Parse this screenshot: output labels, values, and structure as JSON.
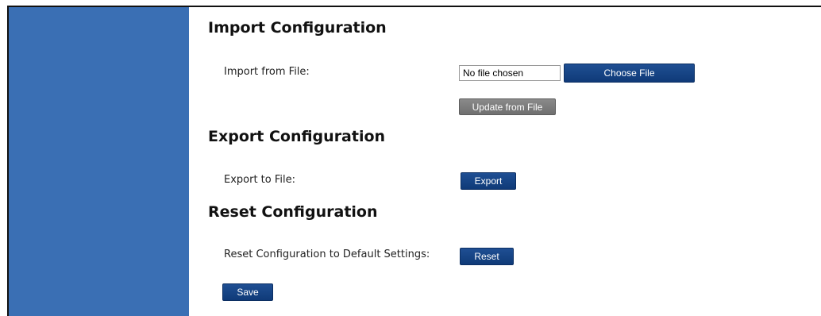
{
  "import": {
    "heading": "Import Configuration",
    "file_label": "Import from File:",
    "file_status": "No file chosen",
    "choose_button": "Choose File",
    "update_button": "Update from File"
  },
  "export": {
    "heading": "Export Configuration",
    "label": "Export to File:",
    "button": "Export"
  },
  "reset": {
    "heading": "Reset Configuration",
    "label": "Reset Configuration to Default Settings:",
    "button": "Reset"
  },
  "save_button": "Save",
  "colors": {
    "sidebar": "#3a6fb4",
    "primary_button": "#1a4a8c",
    "disabled_button": "#7c7c7c"
  }
}
